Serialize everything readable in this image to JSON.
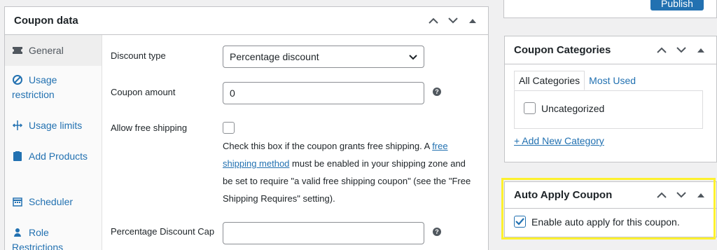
{
  "coupon_panel": {
    "title": "Coupon data",
    "tabs": [
      {
        "label": "General",
        "icon": "ticket-icon"
      },
      {
        "label": "Usage restriction",
        "icon": "block-icon"
      },
      {
        "label": "Usage limits",
        "icon": "limits-icon"
      },
      {
        "label": "Add Products",
        "icon": "product-icon"
      },
      {
        "label": "Scheduler",
        "icon": "calendar-icon"
      },
      {
        "label": "Role Restrictions",
        "icon": "person-icon"
      }
    ],
    "fields": {
      "discount_type_label": "Discount type",
      "discount_type_value": "Percentage discount",
      "coupon_amount_label": "Coupon amount",
      "coupon_amount_value": "0",
      "free_shipping_label": "Allow free shipping",
      "free_shipping_desc_1": "Check this box if the coupon grants free shipping. A ",
      "free_shipping_link": "free shipping method",
      "free_shipping_desc_2": " must be enabled in your shipping zone and be set to require \"a valid free shipping coupon\" (see the \"Free Shipping Requires\" setting).",
      "percentage_cap_label": "Percentage Discount Cap",
      "percentage_cap_value": "",
      "help_glyph": "?"
    }
  },
  "publish": {
    "button_label": "Publish"
  },
  "categories_panel": {
    "title": "Coupon Categories",
    "tab_all": "All Categories",
    "tab_most_used": "Most Used",
    "items": [
      "Uncategorized"
    ],
    "add_new": "+ Add New Category"
  },
  "auto_apply_panel": {
    "title": "Auto Apply Coupon",
    "checkbox_label": "Enable auto apply for this coupon.",
    "checked": true
  },
  "colors": {
    "link": "#2271b1",
    "highlight": "#fdf12e",
    "border": "#c3c4c7"
  }
}
